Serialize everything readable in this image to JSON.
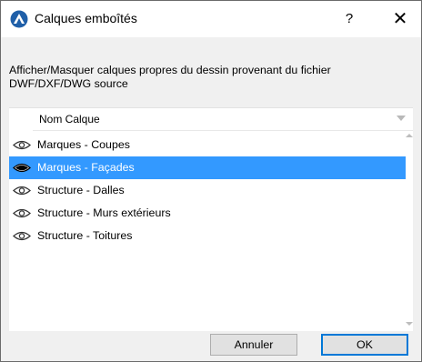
{
  "window": {
    "title": "Calques emboîtés",
    "help_label": "?",
    "close_label": "✕",
    "icon": "archicad-logo-icon"
  },
  "description": "Afficher/Masquer calques propres du dessin provenant du fichier DWF/DXF/DWG source",
  "list": {
    "column_header": "Nom Calque",
    "rows": [
      {
        "label": "Marques - Coupes",
        "visible": true,
        "selected": false
      },
      {
        "label": "Marques - Façades",
        "visible": false,
        "selected": true
      },
      {
        "label": "Structure - Dalles",
        "visible": true,
        "selected": false
      },
      {
        "label": "Structure - Murs extérieurs",
        "visible": true,
        "selected": false
      },
      {
        "label": "Structure - Toitures",
        "visible": true,
        "selected": false
      }
    ]
  },
  "buttons": {
    "cancel": "Annuler",
    "ok": "OK"
  },
  "colors": {
    "selection": "#3399ff",
    "ok_border": "#0078d7"
  }
}
